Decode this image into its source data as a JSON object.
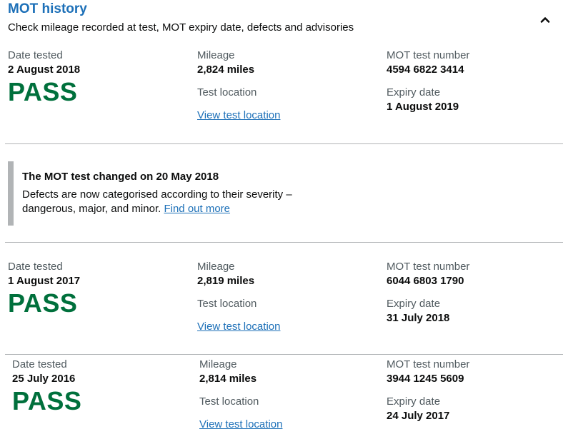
{
  "header": {
    "title": "MOT history",
    "subtitle": "Check mileage recorded at test, MOT expiry date, defects and advisories"
  },
  "labels": {
    "date_tested": "Date tested",
    "mileage": "Mileage",
    "test_location": "Test location",
    "view_test_location": "View test location",
    "mot_test_number": "MOT test number",
    "expiry_date": "Expiry date"
  },
  "records": [
    {
      "date_tested": "2 August 2018",
      "result": "PASS",
      "mileage": "2,824 miles",
      "mot_test_number": "4594 6822 3414",
      "expiry_date": "1 August 2019"
    },
    {
      "date_tested": "1 August 2017",
      "result": "PASS",
      "mileage": "2,819 miles",
      "mot_test_number": "6044 6803 1790",
      "expiry_date": "31 July 2018"
    },
    {
      "date_tested": "25 July 2016",
      "result": "PASS",
      "mileage": "2,814 miles",
      "mot_test_number": "3944 1245 5609",
      "expiry_date": "24 July 2017"
    }
  ],
  "notice": {
    "title": "The MOT test changed on 20 May 2018",
    "body": "Defects are now categorised according to their severity – dangerous, major, and minor.",
    "link": "Find out more"
  },
  "colors": {
    "pass": "#00703c",
    "link": "#1d70b8",
    "border": "#b1b4b6"
  },
  "icons": {
    "collapse": "chevron-up-icon"
  }
}
